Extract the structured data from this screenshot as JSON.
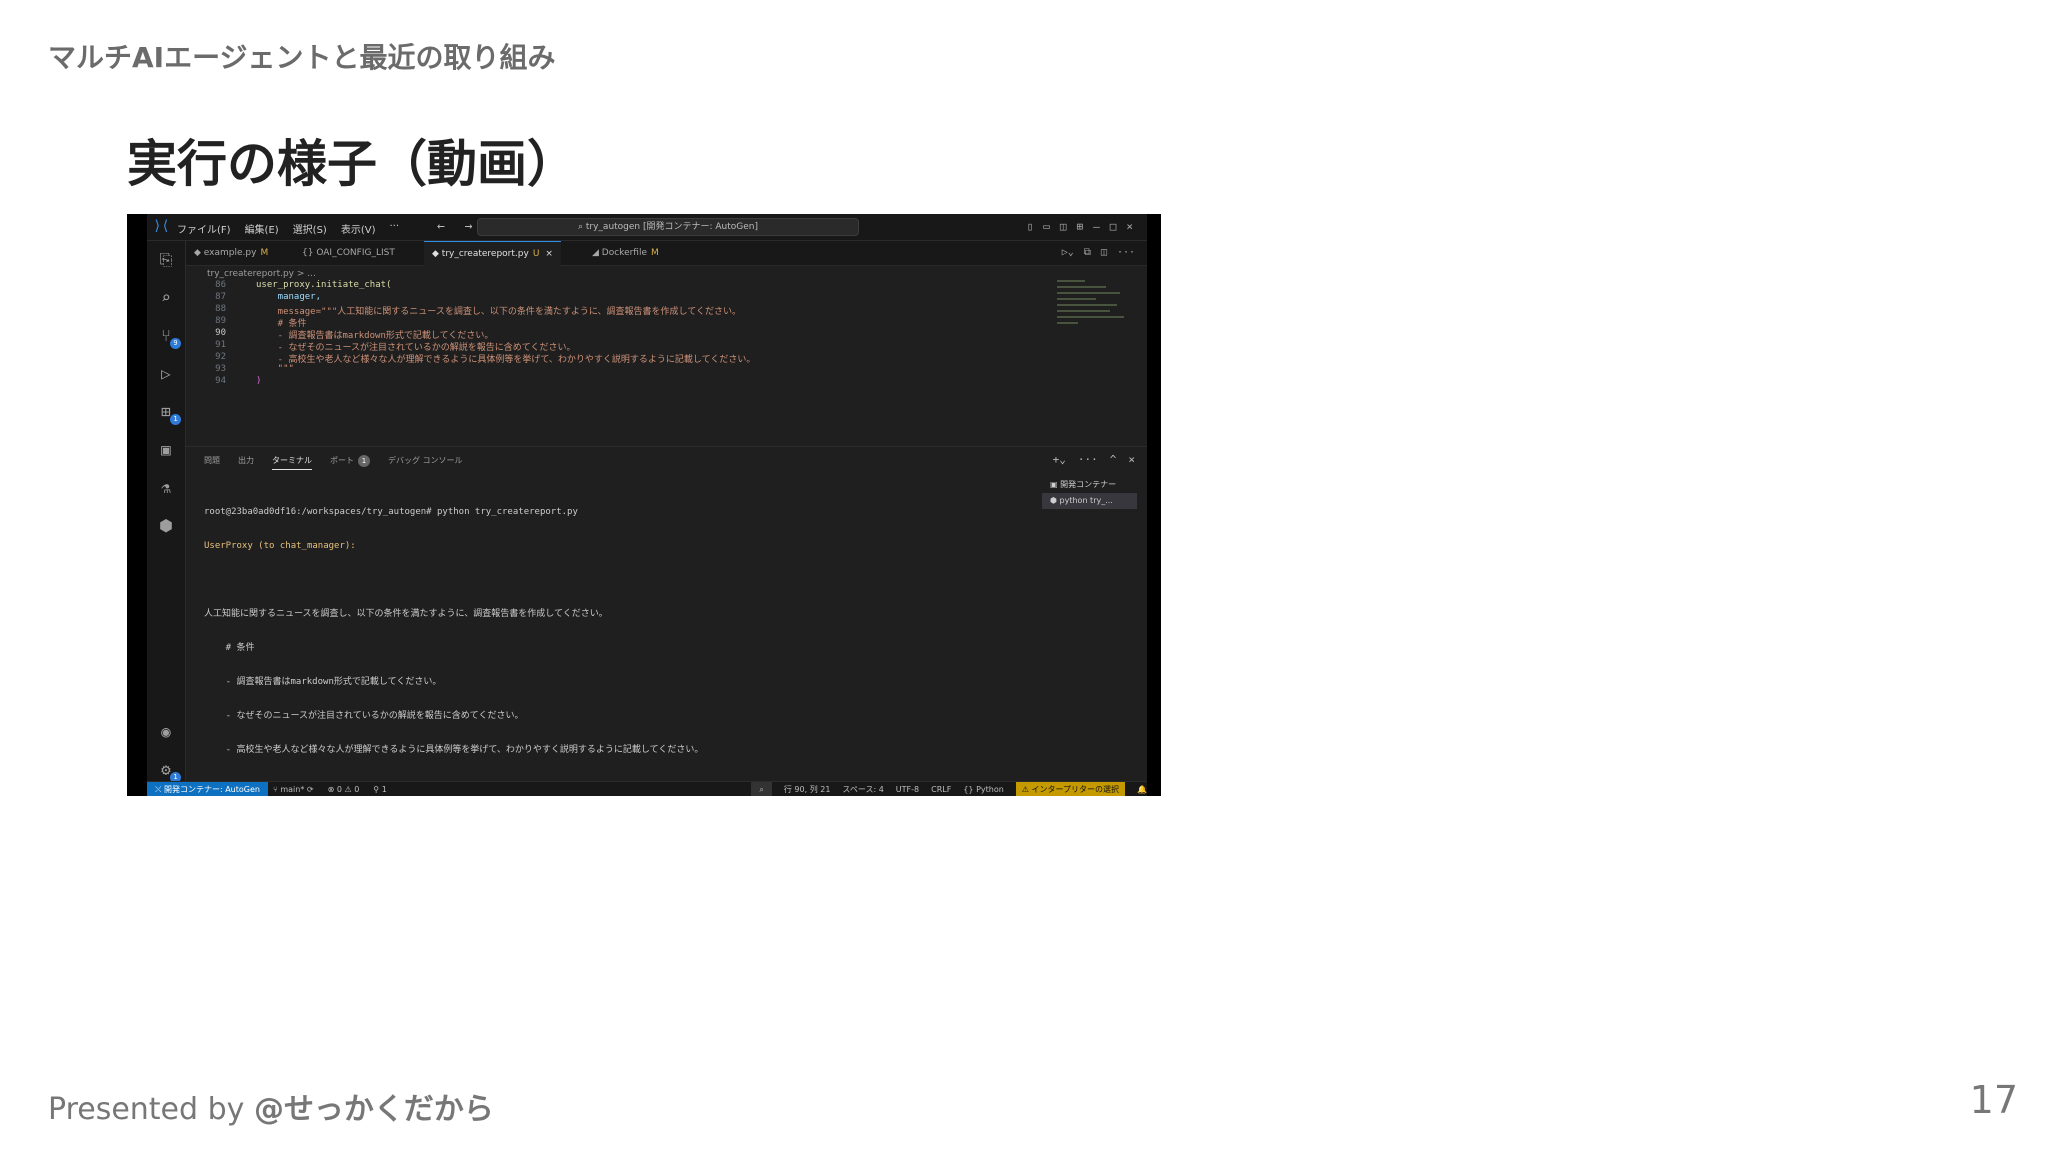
{
  "slide": {
    "header": "マルチAIエージェントと最近の取り組み",
    "title": "実行の様子（動画）",
    "footer_prefix": "Presented by ",
    "footer_handle": "@せっかくだから",
    "page_number": "17"
  },
  "vscode": {
    "menu": [
      "ファイル(F)",
      "編集(E)",
      "選択(S)",
      "表示(V)",
      "···"
    ],
    "command_center": "try_autogen [開発コンテナー: AutoGen]",
    "tabs": [
      {
        "label": "example.py",
        "mod": "M"
      },
      {
        "label": "OAI_CONFIG_LIST",
        "mod": ""
      },
      {
        "label": "try_createreport.py",
        "mod": "U",
        "close": "×"
      },
      {
        "label": "Dockerfile",
        "mod": "M"
      }
    ],
    "breadcrumb": "try_createreport.py > ...",
    "code_lines": [
      {
        "n": "86",
        "t": "user_proxy.initiate_chat("
      },
      {
        "n": "87",
        "t": "    manager,"
      },
      {
        "n": "88",
        "t": "    message=\"\"\"人工知能に関するニュースを調査し、以下の条件を満たすように、調査報告書を作成してください。"
      },
      {
        "n": "89",
        "t": "    # 条件"
      },
      {
        "n": "90",
        "t": "    - 調査報告書はmarkdown形式で記載してください。"
      },
      {
        "n": "91",
        "t": "    - なぜそのニュースが注目されているかの解説を報告に含めてください。"
      },
      {
        "n": "92",
        "t": "    - 高校生や老人など様々な人が理解できるように具体例等を挙げて、わかりやすく説明するように記載してください。"
      },
      {
        "n": "93",
        "t": "    \"\"\""
      },
      {
        "n": "94",
        "t": ")"
      }
    ],
    "panel_tabs": [
      "問題",
      "出力",
      "ターミナル",
      "ポート",
      "デバッグ コンソール"
    ],
    "ports_badge": "1",
    "terminals": [
      "開発コンテナー",
      "python try_..."
    ],
    "terminal_lines": [
      "root@23ba0ad0df16:/workspaces/try_autogen# python try_createreport.py",
      "UserProxy (to chat_manager):",
      "",
      "人工知能に関するニュースを調査し、以下の条件を満たすように、調査報告書を作成してください。",
      "    # 条件",
      "    - 調査報告書はmarkdown形式で記載してください。",
      "    - なぜそのニュースが注目されているかの解説を報告に含めてください。",
      "    - 高校生や老人など様々な人が理解できるように具体例等を挙げて、わかりやすく説明するように記載してください。",
      "",
      "--------------------------------------------------------------------------------"
    ],
    "status": {
      "remote": "開発コンテナー: AutoGen",
      "branch": "main*",
      "problems": "⊗ 0 ⚠ 0",
      "ports": "1",
      "position": "行 90, 列 21",
      "spaces": "スペース: 4",
      "encoding": "UTF-8",
      "eol": "CRLF",
      "language": "Python",
      "interpreter": "⚠ インタープリターの選択"
    }
  }
}
